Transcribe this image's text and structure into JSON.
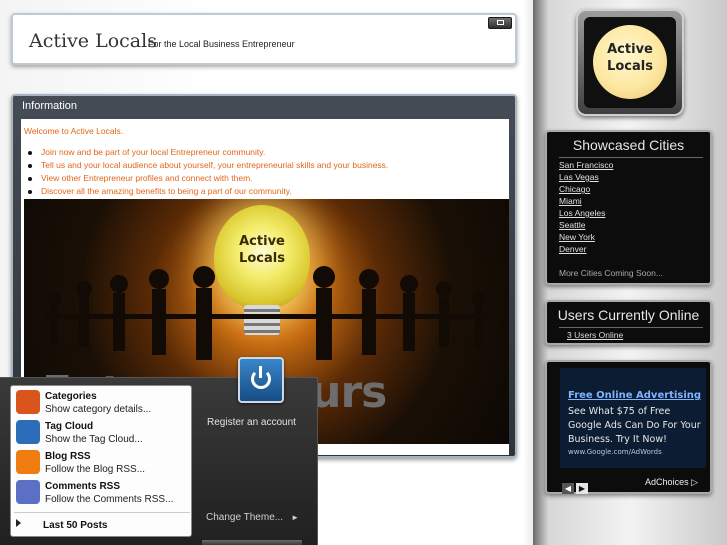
{
  "header": {
    "title": "Active Locals",
    "tagline": "For the Local Business Entrepreneur"
  },
  "info_panel": {
    "title": "Information",
    "welcome": "Welcome to Active Locals.",
    "bullets": [
      "Join now and be part of your local Entrepreneur community.",
      "Tell us and your local audience about yourself, your entrepreneurial skills and your business.",
      "View other Entrepreneur profiles and connect with them.",
      "Discover all the amazing benefits to being a part of our community."
    ],
    "banner": {
      "bulb_text": "Active Locals",
      "headline": "Entrepreneurs Unite"
    }
  },
  "logo": {
    "text": "Active Locals"
  },
  "cities_panel": {
    "title": "Showcased Cities",
    "cities": [
      "San Francisco",
      "Las Vegas",
      "Chicago",
      "Miami",
      "Los Angeles",
      "Seattle",
      "New York",
      "Denver"
    ],
    "more": "More Cities Coming Soon..."
  },
  "online_panel": {
    "title": "Users Currently Online",
    "link": "3 Users Online"
  },
  "ad_panel": {
    "title": "Free Online Advertising",
    "body": "See What $75 of Free Google Ads Can Do For Your Business. Try It Now!",
    "url": "www.Google.com/AdWords",
    "adchoices": "AdChoices ▷"
  },
  "start_menu": {
    "items": [
      {
        "title": "Categories",
        "sub": "Show category details...",
        "icon": "categories-icon",
        "color": "#d9551c"
      },
      {
        "title": "Tag Cloud",
        "sub": "Show the Tag Cloud...",
        "icon": "tag-icon",
        "color": "#2d6db8"
      },
      {
        "title": "Blog RSS",
        "sub": "Follow the Blog RSS...",
        "icon": "rss-icon",
        "color": "#f07c12"
      },
      {
        "title": "Comments RSS",
        "sub": "Follow the Comments RSS...",
        "icon": "comments-rss-icon",
        "color": "#5b6fc4"
      }
    ],
    "last_posts": "Last 50 Posts"
  },
  "dock": {
    "register": "Register an account",
    "change_theme": "Change Theme...",
    "change_theme_arrow": "►"
  },
  "colors": {
    "accent": "#e2661a",
    "panel_dark": "#0c0c0c",
    "ad_link": "#7fb4ff"
  }
}
